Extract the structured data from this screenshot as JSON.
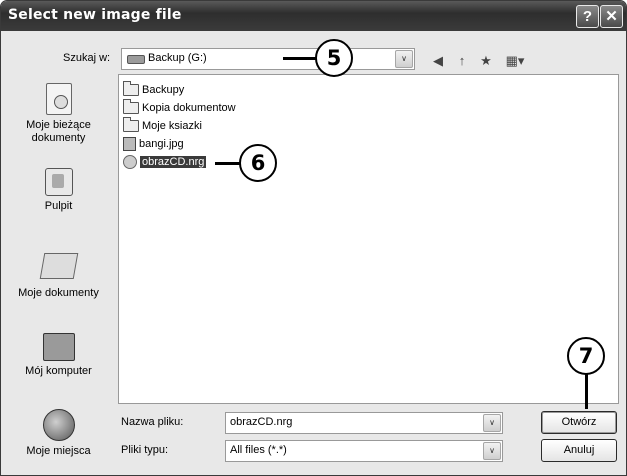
{
  "window": {
    "title": "Select new image file",
    "help_glyph": "?",
    "close_glyph": "✕"
  },
  "lookin": {
    "label": "Szukaj w:",
    "value": "Backup (G:)",
    "toolbar_glyphs": {
      "back": "◀",
      "up": "↑",
      "new_folder": "★",
      "views": "▦▾"
    }
  },
  "places": [
    {
      "label": "Moje bieżące dokumenty",
      "icon": "recent-documents-icon"
    },
    {
      "label": "Pulpit",
      "icon": "desktop-icon"
    },
    {
      "label": "Moje dokumenty",
      "icon": "my-documents-icon"
    },
    {
      "label": "Mój komputer",
      "icon": "my-computer-icon"
    },
    {
      "label": "Moje miejsca",
      "icon": "network-places-icon"
    }
  ],
  "files": [
    {
      "name": "Backupy",
      "type": "folder"
    },
    {
      "name": "Kopia dokumentow",
      "type": "folder"
    },
    {
      "name": "Moje ksiazki",
      "type": "folder"
    },
    {
      "name": "bangi.jpg",
      "type": "image"
    },
    {
      "name": "obrazCD.nrg",
      "type": "nrg",
      "selected": true
    }
  ],
  "filename": {
    "label": "Nazwa pliku:",
    "value": "obrazCD.nrg"
  },
  "filetype": {
    "label": "Pliki typu:",
    "value": "All files (*.*)"
  },
  "buttons": {
    "open": "Otwórz",
    "cancel": "Anuluj"
  },
  "callouts": [
    "5",
    "6",
    "7"
  ],
  "dropdown_glyph": "∨"
}
